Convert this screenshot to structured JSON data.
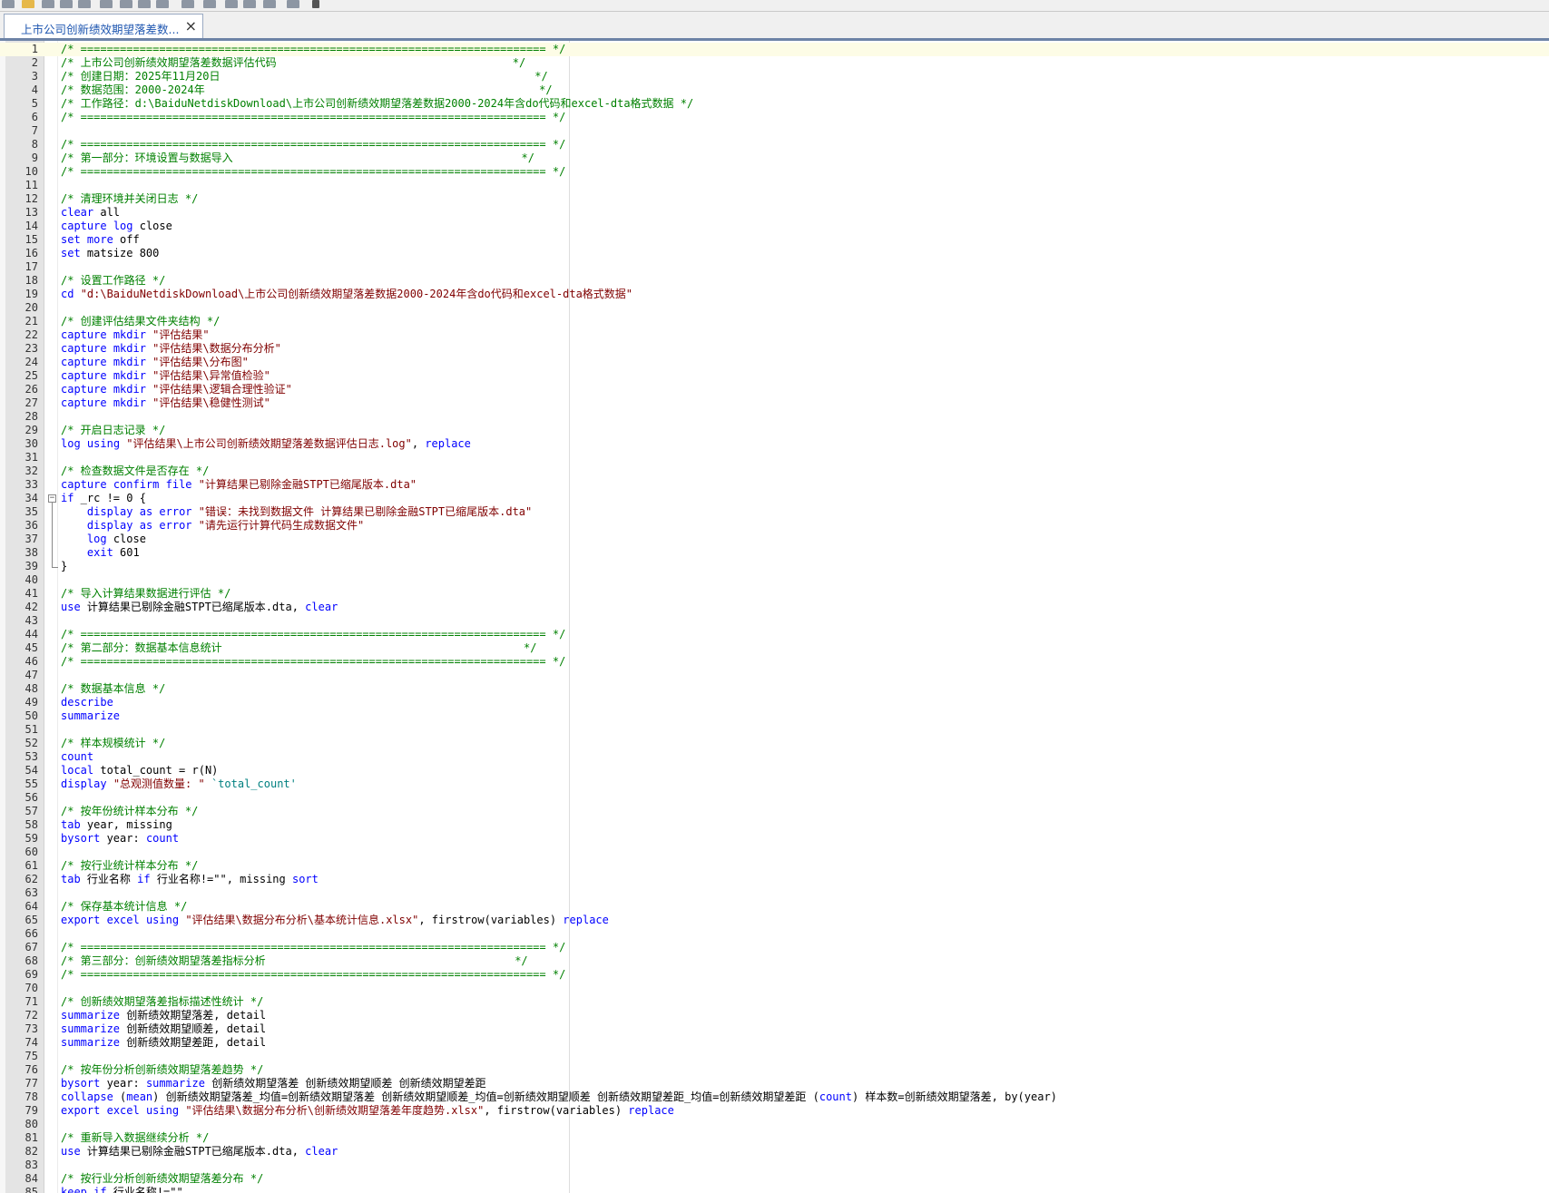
{
  "tab": {
    "title": "上市公司创新绩效期望落差数...",
    "close_symbol": "×"
  },
  "toolbar": {
    "icons": [
      "new-file-icon",
      "open-folder-icon",
      "save-icon",
      "save-all-icon",
      "print-icon",
      "find-icon",
      "cut-icon",
      "copy-icon",
      "paste-icon",
      "undo-icon",
      "redo-icon",
      "bookmark-icon",
      "bookmark-next-icon",
      "bookmark-prev-icon",
      "run-icon",
      "dropdown-icon"
    ]
  },
  "colors": {
    "comment": "#008000",
    "keyword": "#0000ff",
    "string": "#800000",
    "local_macro": "#008080",
    "current_line": "#fdfce6",
    "gutter": "#e4e4e4"
  },
  "editor": {
    "current_line": 1,
    "lines": [
      {
        "n": "1",
        "tokens": [
          [
            "c",
            "/* ======================================================================= */"
          ]
        ]
      },
      {
        "n": "2",
        "tokens": [
          [
            "c",
            "/* 上市公司创新绩效期望落差数据评估代码                                    */"
          ]
        ]
      },
      {
        "n": "3",
        "tokens": [
          [
            "c",
            "/* 创建日期：2025年11月20日                                                */"
          ]
        ]
      },
      {
        "n": "4",
        "tokens": [
          [
            "c",
            "/* 数据范围：2000-2024年                                                   */"
          ]
        ]
      },
      {
        "n": "5",
        "tokens": [
          [
            "c",
            "/* 工作路径：d:\\BaiduNetdiskDownload\\上市公司创新绩效期望落差数据2000-2024年含do代码和excel-dta格式数据 */"
          ]
        ]
      },
      {
        "n": "6",
        "tokens": [
          [
            "c",
            "/* ======================================================================= */"
          ]
        ]
      },
      {
        "n": "7",
        "tokens": []
      },
      {
        "n": "8",
        "tokens": [
          [
            "c",
            "/* ======================================================================= */"
          ]
        ]
      },
      {
        "n": "9",
        "tokens": [
          [
            "c",
            "/* 第一部分：环境设置与数据导入                                            */"
          ]
        ]
      },
      {
        "n": "10",
        "tokens": [
          [
            "c",
            "/* ======================================================================= */"
          ]
        ]
      },
      {
        "n": "11",
        "tokens": []
      },
      {
        "n": "12",
        "tokens": [
          [
            "c",
            "/* 清理环境并关闭日志 */"
          ]
        ]
      },
      {
        "n": "13",
        "tokens": [
          [
            "k",
            "clear"
          ],
          [
            "p",
            " all"
          ]
        ]
      },
      {
        "n": "14",
        "tokens": [
          [
            "k",
            "capture"
          ],
          [
            "p",
            " "
          ],
          [
            "k",
            "log"
          ],
          [
            "p",
            " close"
          ]
        ]
      },
      {
        "n": "15",
        "tokens": [
          [
            "k",
            "set"
          ],
          [
            "p",
            " "
          ],
          [
            "k",
            "more"
          ],
          [
            "p",
            " off"
          ]
        ]
      },
      {
        "n": "16",
        "tokens": [
          [
            "k",
            "set"
          ],
          [
            "p",
            " matsize 800"
          ]
        ]
      },
      {
        "n": "17",
        "tokens": []
      },
      {
        "n": "18",
        "tokens": [
          [
            "c",
            "/* 设置工作路径 */"
          ]
        ]
      },
      {
        "n": "19",
        "tokens": [
          [
            "k",
            "cd"
          ],
          [
            "p",
            " "
          ],
          [
            "s",
            "\"d:\\BaiduNetdiskDownload\\上市公司创新绩效期望落差数据2000-2024年含do代码和excel-dta格式数据\""
          ]
        ]
      },
      {
        "n": "20",
        "tokens": []
      },
      {
        "n": "21",
        "tokens": [
          [
            "c",
            "/* 创建评估结果文件夹结构 */"
          ]
        ]
      },
      {
        "n": "22",
        "tokens": [
          [
            "k",
            "capture"
          ],
          [
            "p",
            " "
          ],
          [
            "k",
            "mkdir"
          ],
          [
            "p",
            " "
          ],
          [
            "s",
            "\"评估结果\""
          ]
        ]
      },
      {
        "n": "23",
        "tokens": [
          [
            "k",
            "capture"
          ],
          [
            "p",
            " "
          ],
          [
            "k",
            "mkdir"
          ],
          [
            "p",
            " "
          ],
          [
            "s",
            "\"评估结果\\数据分布分析\""
          ]
        ]
      },
      {
        "n": "24",
        "tokens": [
          [
            "k",
            "capture"
          ],
          [
            "p",
            " "
          ],
          [
            "k",
            "mkdir"
          ],
          [
            "p",
            " "
          ],
          [
            "s",
            "\"评估结果\\分布图\""
          ]
        ]
      },
      {
        "n": "25",
        "tokens": [
          [
            "k",
            "capture"
          ],
          [
            "p",
            " "
          ],
          [
            "k",
            "mkdir"
          ],
          [
            "p",
            " "
          ],
          [
            "s",
            "\"评估结果\\异常值检验\""
          ]
        ]
      },
      {
        "n": "26",
        "tokens": [
          [
            "k",
            "capture"
          ],
          [
            "p",
            " "
          ],
          [
            "k",
            "mkdir"
          ],
          [
            "p",
            " "
          ],
          [
            "s",
            "\"评估结果\\逻辑合理性验证\""
          ]
        ]
      },
      {
        "n": "27",
        "tokens": [
          [
            "k",
            "capture"
          ],
          [
            "p",
            " "
          ],
          [
            "k",
            "mkdir"
          ],
          [
            "p",
            " "
          ],
          [
            "s",
            "\"评估结果\\稳健性测试\""
          ]
        ]
      },
      {
        "n": "28",
        "tokens": []
      },
      {
        "n": "29",
        "tokens": [
          [
            "c",
            "/* 开启日志记录 */"
          ]
        ]
      },
      {
        "n": "30",
        "tokens": [
          [
            "k",
            "log"
          ],
          [
            "p",
            " "
          ],
          [
            "k",
            "using"
          ],
          [
            "p",
            " "
          ],
          [
            "s",
            "\"评估结果\\上市公司创新绩效期望落差数据评估日志.log\""
          ],
          [
            "p",
            ", "
          ],
          [
            "k",
            "replace"
          ]
        ]
      },
      {
        "n": "31",
        "tokens": []
      },
      {
        "n": "32",
        "tokens": [
          [
            "c",
            "/* 检查数据文件是否存在 */"
          ]
        ]
      },
      {
        "n": "33",
        "tokens": [
          [
            "k",
            "capture"
          ],
          [
            "p",
            " "
          ],
          [
            "k",
            "confirm"
          ],
          [
            "p",
            " "
          ],
          [
            "k",
            "file"
          ],
          [
            "p",
            " "
          ],
          [
            "s",
            "\"计算结果已剔除金融STPT已缩尾版本.dta\""
          ]
        ]
      },
      {
        "n": "34",
        "fold": "start",
        "tokens": [
          [
            "k",
            "if"
          ],
          [
            "p",
            " _rc != 0 {"
          ]
        ]
      },
      {
        "n": "35",
        "fold": "mid",
        "tokens": [
          [
            "p",
            "    "
          ],
          [
            "k",
            "display"
          ],
          [
            "p",
            " "
          ],
          [
            "k",
            "as"
          ],
          [
            "p",
            " "
          ],
          [
            "k",
            "error"
          ],
          [
            "p",
            " "
          ],
          [
            "s",
            "\"错误：未找到数据文件 计算结果已剔除金融STPT已缩尾版本.dta\""
          ]
        ]
      },
      {
        "n": "36",
        "fold": "mid",
        "tokens": [
          [
            "p",
            "    "
          ],
          [
            "k",
            "display"
          ],
          [
            "p",
            " "
          ],
          [
            "k",
            "as"
          ],
          [
            "p",
            " "
          ],
          [
            "k",
            "error"
          ],
          [
            "p",
            " "
          ],
          [
            "s",
            "\"请先运行计算代码生成数据文件\""
          ]
        ]
      },
      {
        "n": "37",
        "fold": "mid",
        "tokens": [
          [
            "p",
            "    "
          ],
          [
            "k",
            "log"
          ],
          [
            "p",
            " close"
          ]
        ]
      },
      {
        "n": "38",
        "fold": "mid",
        "tokens": [
          [
            "p",
            "    "
          ],
          [
            "k",
            "exit"
          ],
          [
            "p",
            " 601"
          ]
        ]
      },
      {
        "n": "39",
        "fold": "end",
        "tokens": [
          [
            "p",
            "}"
          ]
        ]
      },
      {
        "n": "40",
        "tokens": []
      },
      {
        "n": "41",
        "tokens": [
          [
            "c",
            "/* 导入计算结果数据进行评估 */"
          ]
        ]
      },
      {
        "n": "42",
        "tokens": [
          [
            "k",
            "use"
          ],
          [
            "p",
            " 计算结果已剔除金融STPT已缩尾版本.dta, "
          ],
          [
            "k",
            "clear"
          ]
        ]
      },
      {
        "n": "43",
        "tokens": []
      },
      {
        "n": "44",
        "tokens": [
          [
            "c",
            "/* ======================================================================= */"
          ]
        ]
      },
      {
        "n": "45",
        "tokens": [
          [
            "c",
            "/* 第二部分：数据基本信息统计                                              */"
          ]
        ]
      },
      {
        "n": "46",
        "tokens": [
          [
            "c",
            "/* ======================================================================= */"
          ]
        ]
      },
      {
        "n": "47",
        "tokens": []
      },
      {
        "n": "48",
        "tokens": [
          [
            "c",
            "/* 数据基本信息 */"
          ]
        ]
      },
      {
        "n": "49",
        "tokens": [
          [
            "k",
            "describe"
          ]
        ]
      },
      {
        "n": "50",
        "tokens": [
          [
            "k",
            "summarize"
          ]
        ]
      },
      {
        "n": "51",
        "tokens": []
      },
      {
        "n": "52",
        "tokens": [
          [
            "c",
            "/* 样本规模统计 */"
          ]
        ]
      },
      {
        "n": "53",
        "tokens": [
          [
            "k",
            "count"
          ]
        ]
      },
      {
        "n": "54",
        "tokens": [
          [
            "k",
            "local"
          ],
          [
            "p",
            " total_count = r(N)"
          ]
        ]
      },
      {
        "n": "55",
        "tokens": [
          [
            "k",
            "display"
          ],
          [
            "p",
            " "
          ],
          [
            "s",
            "\"总观测值数量: \""
          ],
          [
            "p",
            " "
          ],
          [
            "l",
            "`total_count'"
          ]
        ]
      },
      {
        "n": "56",
        "tokens": []
      },
      {
        "n": "57",
        "tokens": [
          [
            "c",
            "/* 按年份统计样本分布 */"
          ]
        ]
      },
      {
        "n": "58",
        "tokens": [
          [
            "k",
            "tab"
          ],
          [
            "p",
            " year, missing"
          ]
        ]
      },
      {
        "n": "59",
        "tokens": [
          [
            "k",
            "bysort"
          ],
          [
            "p",
            " year: "
          ],
          [
            "k",
            "count"
          ]
        ]
      },
      {
        "n": "60",
        "tokens": []
      },
      {
        "n": "61",
        "tokens": [
          [
            "c",
            "/* 按行业统计样本分布 */"
          ]
        ]
      },
      {
        "n": "62",
        "tokens": [
          [
            "k",
            "tab"
          ],
          [
            "p",
            " 行业名称 "
          ],
          [
            "k",
            "if"
          ],
          [
            "p",
            " 行业名称!=\"\", missing "
          ],
          [
            "k",
            "sort"
          ]
        ]
      },
      {
        "n": "63",
        "tokens": []
      },
      {
        "n": "64",
        "tokens": [
          [
            "c",
            "/* 保存基本统计信息 */"
          ]
        ]
      },
      {
        "n": "65",
        "tokens": [
          [
            "k",
            "export"
          ],
          [
            "p",
            " "
          ],
          [
            "k",
            "excel"
          ],
          [
            "p",
            " "
          ],
          [
            "k",
            "using"
          ],
          [
            "p",
            " "
          ],
          [
            "s",
            "\"评估结果\\数据分布分析\\基本统计信息.xlsx\""
          ],
          [
            "p",
            ", firstrow(variables) "
          ],
          [
            "k",
            "replace"
          ]
        ]
      },
      {
        "n": "66",
        "tokens": []
      },
      {
        "n": "67",
        "tokens": [
          [
            "c",
            "/* ======================================================================= */"
          ]
        ]
      },
      {
        "n": "68",
        "tokens": [
          [
            "c",
            "/* 第三部分：创新绩效期望落差指标分析                                      */"
          ]
        ]
      },
      {
        "n": "69",
        "tokens": [
          [
            "c",
            "/* ======================================================================= */"
          ]
        ]
      },
      {
        "n": "70",
        "tokens": []
      },
      {
        "n": "71",
        "tokens": [
          [
            "c",
            "/* 创新绩效期望落差指标描述性统计 */"
          ]
        ]
      },
      {
        "n": "72",
        "tokens": [
          [
            "k",
            "summarize"
          ],
          [
            "p",
            " 创新绩效期望落差, detail"
          ]
        ]
      },
      {
        "n": "73",
        "tokens": [
          [
            "k",
            "summarize"
          ],
          [
            "p",
            " 创新绩效期望顺差, detail"
          ]
        ]
      },
      {
        "n": "74",
        "tokens": [
          [
            "k",
            "summarize"
          ],
          [
            "p",
            " 创新绩效期望差距, detail"
          ]
        ]
      },
      {
        "n": "75",
        "tokens": []
      },
      {
        "n": "76",
        "tokens": [
          [
            "c",
            "/* 按年份分析创新绩效期望落差趋势 */"
          ]
        ]
      },
      {
        "n": "77",
        "tokens": [
          [
            "k",
            "bysort"
          ],
          [
            "p",
            " year: "
          ],
          [
            "k",
            "summarize"
          ],
          [
            "p",
            " 创新绩效期望落差 创新绩效期望顺差 创新绩效期望差距"
          ]
        ]
      },
      {
        "n": "78",
        "tokens": [
          [
            "k",
            "collapse"
          ],
          [
            "p",
            " ("
          ],
          [
            "k",
            "mean"
          ],
          [
            "p",
            ") 创新绩效期望落差_均值=创新绩效期望落差 创新绩效期望顺差_均值=创新绩效期望顺差 创新绩效期望差距_均值=创新绩效期望差距 ("
          ],
          [
            "k",
            "count"
          ],
          [
            "p",
            ") 样本数=创新绩效期望落差, by(year)"
          ]
        ]
      },
      {
        "n": "79",
        "tokens": [
          [
            "k",
            "export"
          ],
          [
            "p",
            " "
          ],
          [
            "k",
            "excel"
          ],
          [
            "p",
            " "
          ],
          [
            "k",
            "using"
          ],
          [
            "p",
            " "
          ],
          [
            "s",
            "\"评估结果\\数据分布分析\\创新绩效期望落差年度趋势.xlsx\""
          ],
          [
            "p",
            ", firstrow(variables) "
          ],
          [
            "k",
            "replace"
          ]
        ]
      },
      {
        "n": "80",
        "tokens": []
      },
      {
        "n": "81",
        "tokens": [
          [
            "c",
            "/* 重新导入数据继续分析 */"
          ]
        ]
      },
      {
        "n": "82",
        "tokens": [
          [
            "k",
            "use"
          ],
          [
            "p",
            " 计算结果已剔除金融STPT已缩尾版本.dta, "
          ],
          [
            "k",
            "clear"
          ]
        ]
      },
      {
        "n": "83",
        "tokens": []
      },
      {
        "n": "84",
        "tokens": [
          [
            "c",
            "/* 按行业分析创新绩效期望落差分布 */"
          ]
        ]
      },
      {
        "n": "85",
        "tokens": [
          [
            "k",
            "keep"
          ],
          [
            "p",
            " "
          ],
          [
            "k",
            "if"
          ],
          [
            "p",
            " 行业名称!=\"\""
          ]
        ]
      }
    ]
  }
}
